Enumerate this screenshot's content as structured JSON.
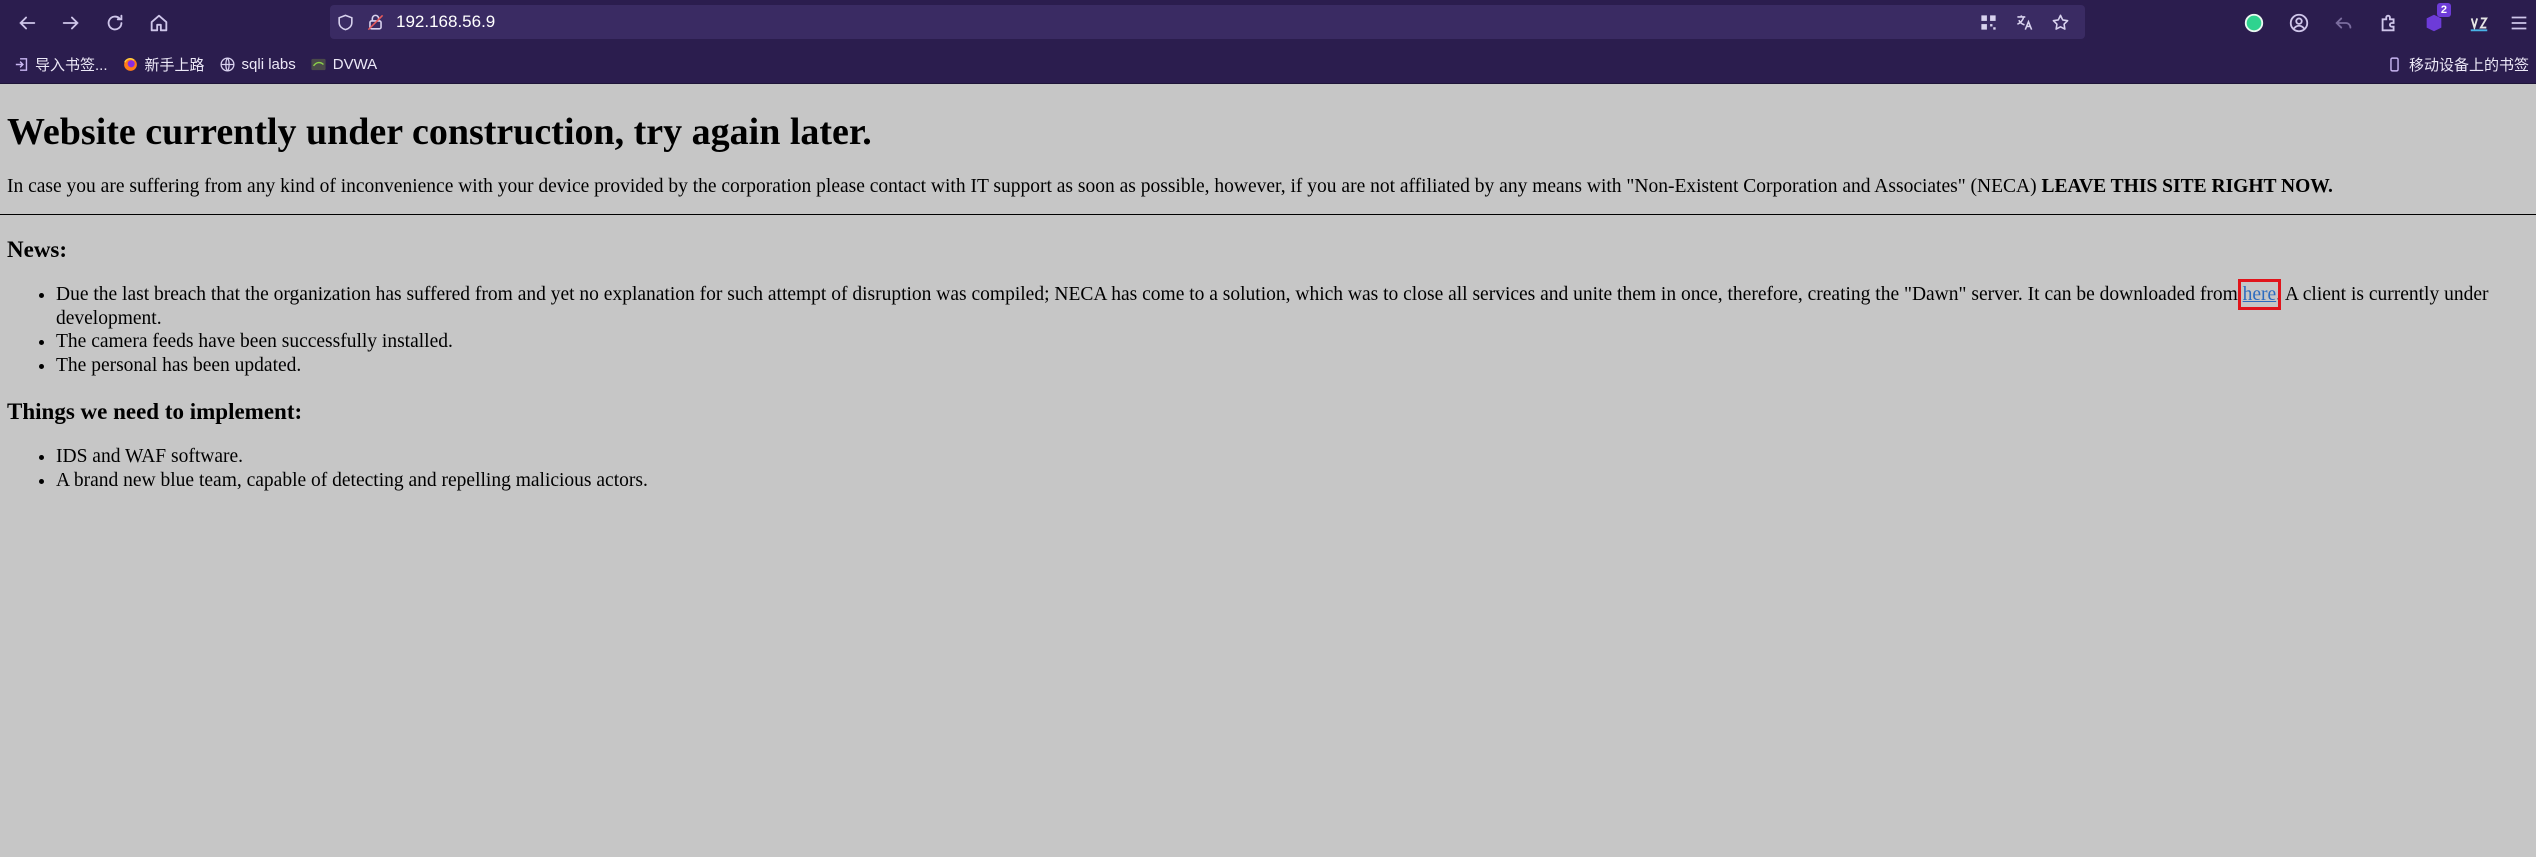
{
  "browser": {
    "url": "192.168.56.9",
    "extension_badge": "2",
    "bookmarks": [
      {
        "label": "导入书签...",
        "icon": "import-icon"
      },
      {
        "label": "新手上路",
        "icon": "firefox-icon"
      },
      {
        "label": "sqli labs",
        "icon": "globe-icon"
      },
      {
        "label": "DVWA",
        "icon": "dvwa-icon"
      }
    ],
    "mobile_bookmarks": "移动设备上的书签"
  },
  "page": {
    "title": "Website currently under construction, try again later.",
    "intro": "In case you are suffering from any kind of inconvenience with your device provided by the corporation please contact with IT support as soon as possible, however, if you are not affiliated by any means with \"Non-Existent Corporation and Associates\" (NECA) ",
    "intro_bold": "LEAVE THIS SITE RIGHT NOW.",
    "news_heading": "News:",
    "news_item_1_before": "Due the last breach that the organization has suffered from and yet no explanation for such attempt of disruption was compiled; NECA has come to a solution, which was to close all services and unite them in once, therefore, creating the \"Dawn\" server. It can be downloaded from ",
    "news_item_1_link": "here",
    "news_item_1_after": ". A client is currently under development.",
    "news_item_2": "The camera feeds have been successfully installed.",
    "news_item_3": "The personal has been updated.",
    "todo_heading": "Things we need to implement:",
    "todo_item_1": "IDS and WAF software.",
    "todo_item_2": "A brand new blue team, capable of detecting and repelling malicious actors."
  },
  "colors": {
    "chrome_bg": "#2b1d4e",
    "page_bg": "#c6c6c6",
    "link": "#2c6bbf",
    "highlight_box": "#e1141b"
  }
}
